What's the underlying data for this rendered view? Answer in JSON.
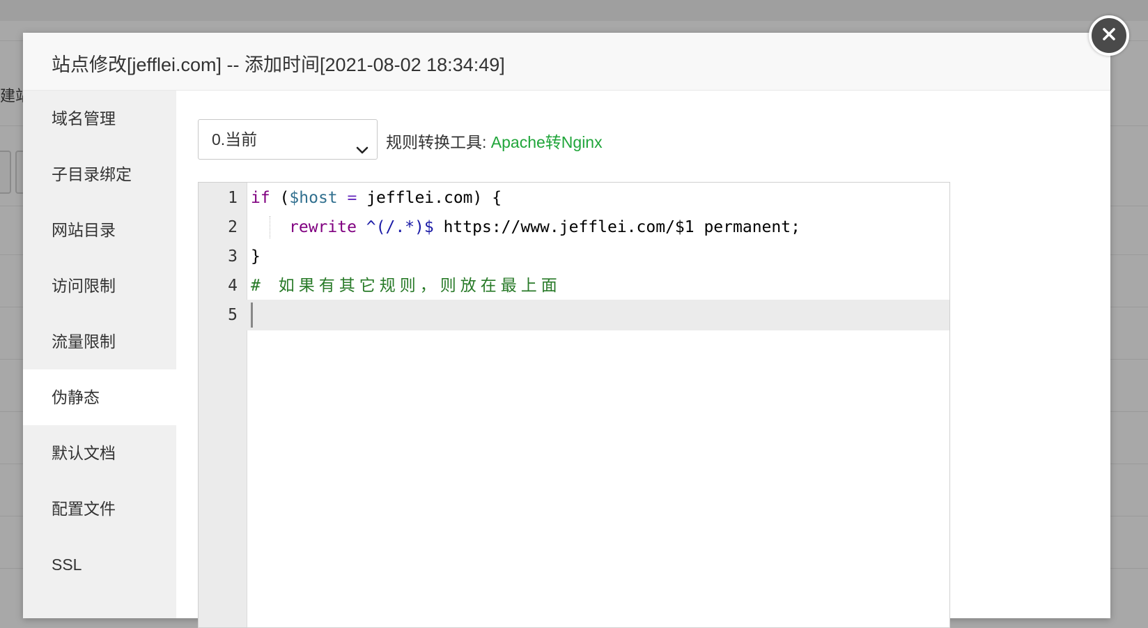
{
  "background": {
    "partial_text": "建站"
  },
  "modal": {
    "title": "站点修改[jefflei.com] -- 添加时间[2021-08-02 18:34:49]"
  },
  "sidebar": {
    "items": [
      {
        "label": "域名管理",
        "active": false
      },
      {
        "label": "子目录绑定",
        "active": false
      },
      {
        "label": "网站目录",
        "active": false
      },
      {
        "label": "访问限制",
        "active": false
      },
      {
        "label": "流量限制",
        "active": false
      },
      {
        "label": "伪静态",
        "active": true
      },
      {
        "label": "默认文档",
        "active": false
      },
      {
        "label": "配置文件",
        "active": false
      },
      {
        "label": "SSL",
        "active": false
      }
    ]
  },
  "rewrite": {
    "select_value": "0.当前",
    "tool_label": "规则转换工具:",
    "tool_link": "Apache转Nginx"
  },
  "editor": {
    "line_numbers": [
      "1",
      "2",
      "3",
      "4",
      "5"
    ],
    "lines": [
      "if ($host = jefflei.com) {",
      "    rewrite ^(/.*)$ https://www.jefflei.com/$1 permanent;",
      "}",
      "# 如果有其它规则，则放在最上面",
      ""
    ],
    "tokens": {
      "if": "if",
      "open_paren": " (",
      "host_var": "$host",
      "eq": " = ",
      "domain": "jefflei.com) {",
      "rewrite": "rewrite",
      "regex": "^(/.*)$",
      "target": " https://www.jefflei.com/$1 permanent;",
      "close_brace": "}",
      "comment": "# 如果有其它规则，则放在最上面"
    }
  },
  "colors": {
    "link": "#20a53a",
    "keyword": "#800080",
    "variable": "#31708f",
    "comment": "#287a28"
  }
}
